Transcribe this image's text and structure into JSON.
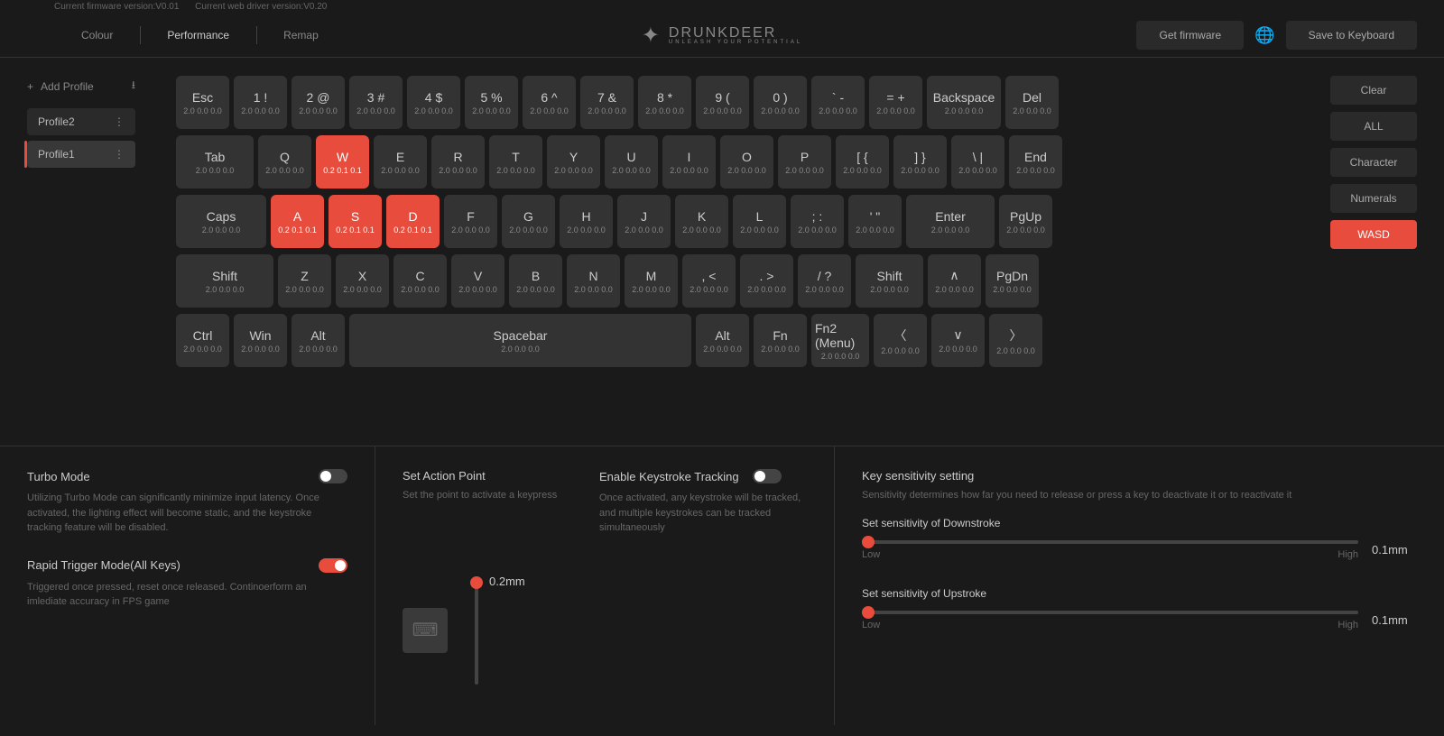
{
  "version": {
    "firmware": "Current firmware version:V0.01",
    "driver": "Current web driver version:V0.20"
  },
  "tabs": {
    "colour": "Colour",
    "performance": "Performance",
    "remap": "Remap"
  },
  "logo": {
    "name": "DRUNKDEER",
    "sub": "UNLEASH YOUR POTENTIAL"
  },
  "header": {
    "get_firmware": "Get firmware",
    "save": "Save to Keyboard"
  },
  "sidebar": {
    "add": "Add Profile",
    "p2": "Profile2",
    "p1": "Profile1"
  },
  "filters": {
    "clear": "Clear",
    "all": "ALL",
    "character": "Character",
    "numerals": "Numerals",
    "wasd": "WASD"
  },
  "vals_default": "2.0  0.0  0.0",
  "vals_wasd": "0.2  0.1  0.1",
  "turbo": {
    "title": "Turbo Mode",
    "desc": "Utilizing Turbo Mode can significantly minimize input latency. Once activated, the lighting effect will become static, and the keystroke tracking feature will be disabled."
  },
  "rapid": {
    "title": "Rapid Trigger Mode(All Keys)",
    "desc": "Triggered once pressed, reset once released. Continoerform an imlediate accuracy in FPS game"
  },
  "action": {
    "title": "Set Action Point",
    "desc": "Set the point to activate a keypress",
    "value": "0.2mm"
  },
  "tracking": {
    "title": "Enable Keystroke Tracking",
    "desc": "Once activated, any keystroke will be tracked, and multiple keystrokes can be tracked simultaneously"
  },
  "sens": {
    "title": "Key sensitivity setting",
    "desc": "Sensitivity determines how far you need to release or press a key to deactivate it or to reactivate it",
    "down": "Set sensitivity of Downstroke",
    "up": "Set sensitivity of Upstroke",
    "val": "0.1mm",
    "low": "Low",
    "high": "High"
  },
  "keys": {
    "r1": [
      "Esc",
      "1 !",
      "2 @",
      "3 #",
      "4 $",
      "5 %",
      "6 ^",
      "7 &",
      "8 *",
      "9 (",
      "0 )",
      "` -",
      "= +",
      "Backspace",
      "Del"
    ],
    "r2": [
      "Tab",
      "Q",
      "W",
      "E",
      "R",
      "T",
      "Y",
      "U",
      "I",
      "O",
      "P",
      "[ {",
      "] }",
      "\\ |",
      "End"
    ],
    "r3": [
      "Caps",
      "A",
      "S",
      "D",
      "F",
      "G",
      "H",
      "J",
      "K",
      "L",
      "; :",
      "' \"",
      "Enter",
      "PgUp"
    ],
    "r4": [
      "Shift",
      "Z",
      "X",
      "C",
      "V",
      "B",
      "N",
      "M",
      ", <",
      ". >",
      "/ ?",
      "Shift",
      "∧",
      "PgDn"
    ],
    "r5": [
      "Ctrl",
      "Win",
      "Alt",
      "Spacebar",
      "Alt",
      "Fn",
      "Fn2 (Menu)",
      "〈",
      "∨",
      "〉"
    ]
  }
}
